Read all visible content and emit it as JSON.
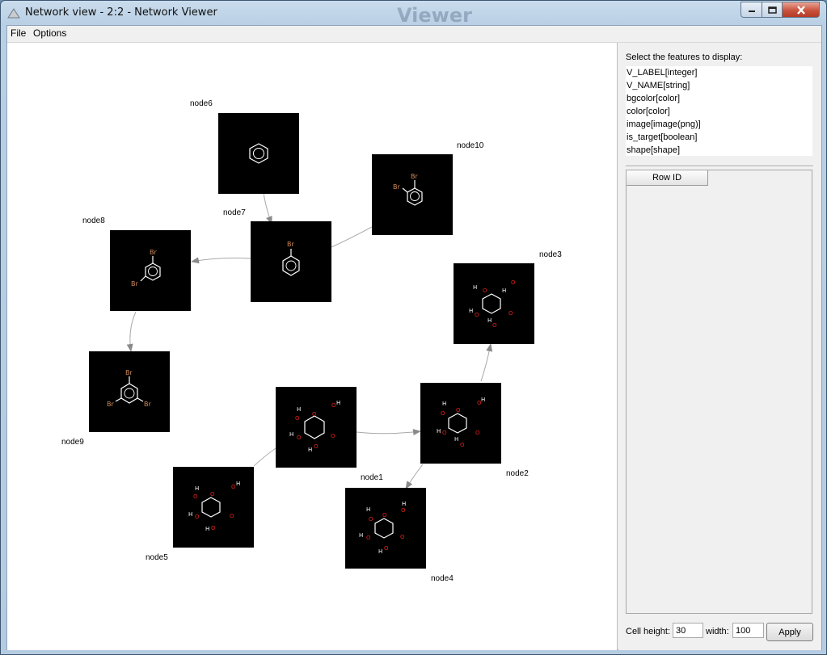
{
  "window": {
    "title": "Network view - 2:2 - Network Viewer",
    "background_text": "Viewer"
  },
  "menu": {
    "file": "File",
    "options": "Options"
  },
  "nodes": [
    {
      "id": "node6",
      "label": "node6"
    },
    {
      "id": "node10",
      "label": "node10"
    },
    {
      "id": "node7",
      "label": "node7"
    },
    {
      "id": "node8",
      "label": "node8"
    },
    {
      "id": "node3",
      "label": "node3"
    },
    {
      "id": "node9",
      "label": "node9"
    },
    {
      "id": "node1",
      "label": "node1"
    },
    {
      "id": "node2",
      "label": "node2"
    },
    {
      "id": "node5",
      "label": "node5"
    },
    {
      "id": "node4",
      "label": "node4"
    }
  ],
  "edges": [
    {
      "from": "node6",
      "to": "node7",
      "directed": true
    },
    {
      "from": "node7",
      "to": "node8",
      "directed": true
    },
    {
      "from": "node8",
      "to": "node9",
      "directed": true
    },
    {
      "from": "node10",
      "to": "node7",
      "directed": false
    },
    {
      "from": "node1",
      "to": "node2",
      "directed": true
    },
    {
      "from": "node2",
      "to": "node3",
      "directed": true
    },
    {
      "from": "node2",
      "to": "node4",
      "directed": true
    },
    {
      "from": "node1",
      "to": "node5",
      "directed": false
    }
  ],
  "molecule_text": {
    "bromine": "Br",
    "hydrogen": "H",
    "oxygen": "O"
  },
  "sidebar": {
    "features_title": "Select the features to display:",
    "features": [
      "V_LABEL[integer]",
      "V_NAME[string]",
      "bgcolor[color]",
      "color[color]",
      "image[image(png)]",
      "is_target[boolean]",
      "shape[shape]"
    ],
    "table_header": "Row ID",
    "cell_height_label": "Cell height:",
    "cell_height_value": "30",
    "width_label": "width:",
    "width_value": "100",
    "apply_label": "Apply"
  },
  "colors": {
    "node_bg": "#000000",
    "edge": "#a0a0a0",
    "bromine": "#d08c5a",
    "oxygen": "#e0211b"
  }
}
